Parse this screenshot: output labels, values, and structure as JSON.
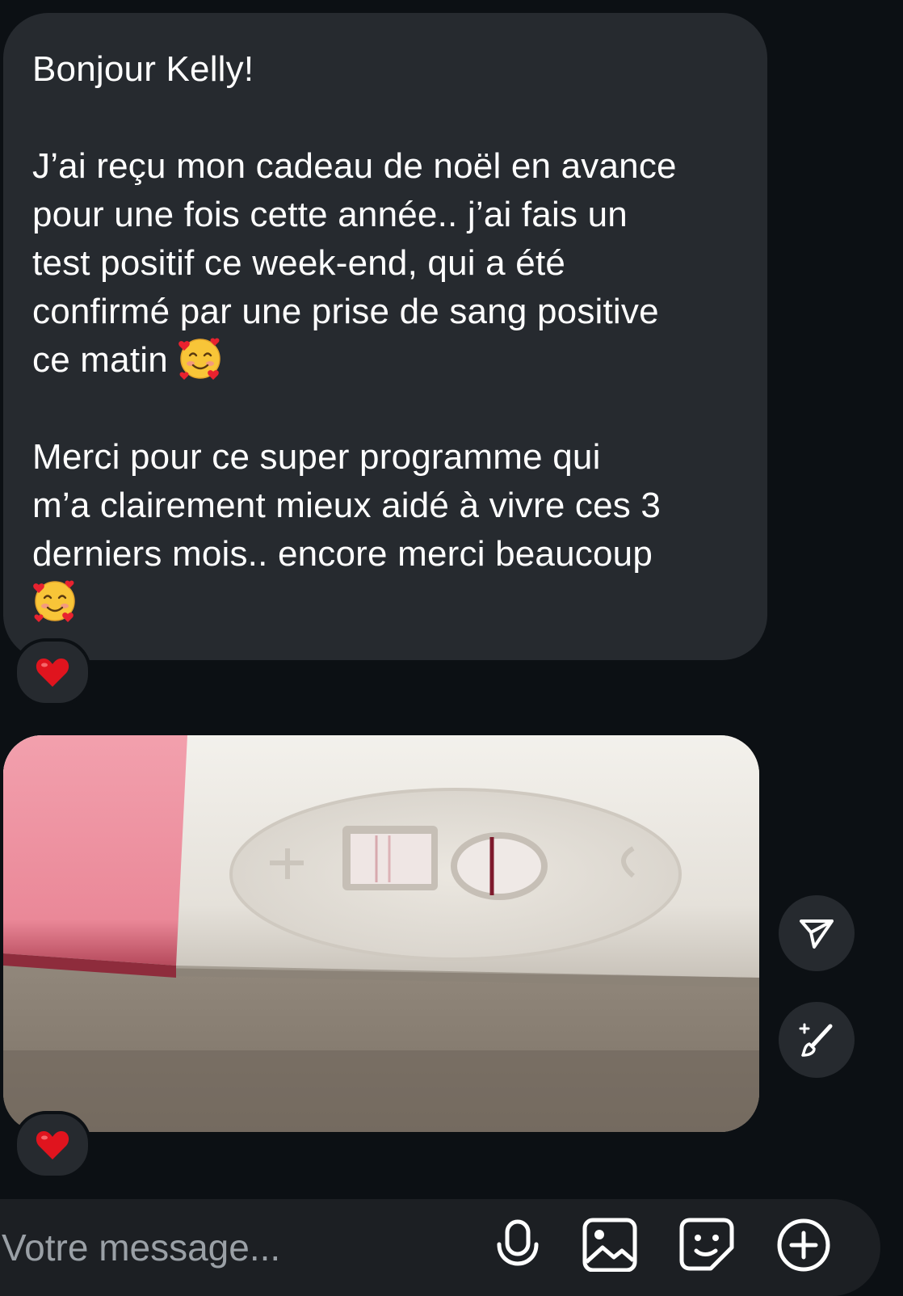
{
  "message": {
    "paragraphs": [
      {
        "text": "Bonjour Kelly!",
        "emoji": ""
      },
      {
        "text": "J’ai reçu mon cadeau de noël en avance\npour une fois cette année.. j’ai fais un\ntest positif ce week-end, qui a été\nconfirmé par une prise de sang positive\nce matin ",
        "emoji": "smiling-face-with-hearts"
      },
      {
        "text": "Merci pour ce super programme qui\nm’a clairement mieux aidé à vivre ces 3\nderniers mois.. encore merci beaucoup\n",
        "emoji": "smiling-face-with-hearts"
      }
    ],
    "reaction": "red-heart",
    "bubble_color": "#262a2f"
  },
  "photo_message": {
    "subject": "pregnancy-test-photo",
    "reaction": "red-heart"
  },
  "side_actions": [
    {
      "name": "share-icon"
    },
    {
      "name": "ai-edit-icon"
    }
  ],
  "composer": {
    "placeholder": "Votre message...",
    "icons": [
      "microphone-icon",
      "image-icon",
      "sticker-icon",
      "plus-circle-icon"
    ]
  },
  "colors": {
    "background": "#0c1014",
    "bubble": "#262a2f",
    "text": "#ffffff",
    "placeholder": "#9aa0a6",
    "heart": "#e0141e"
  }
}
